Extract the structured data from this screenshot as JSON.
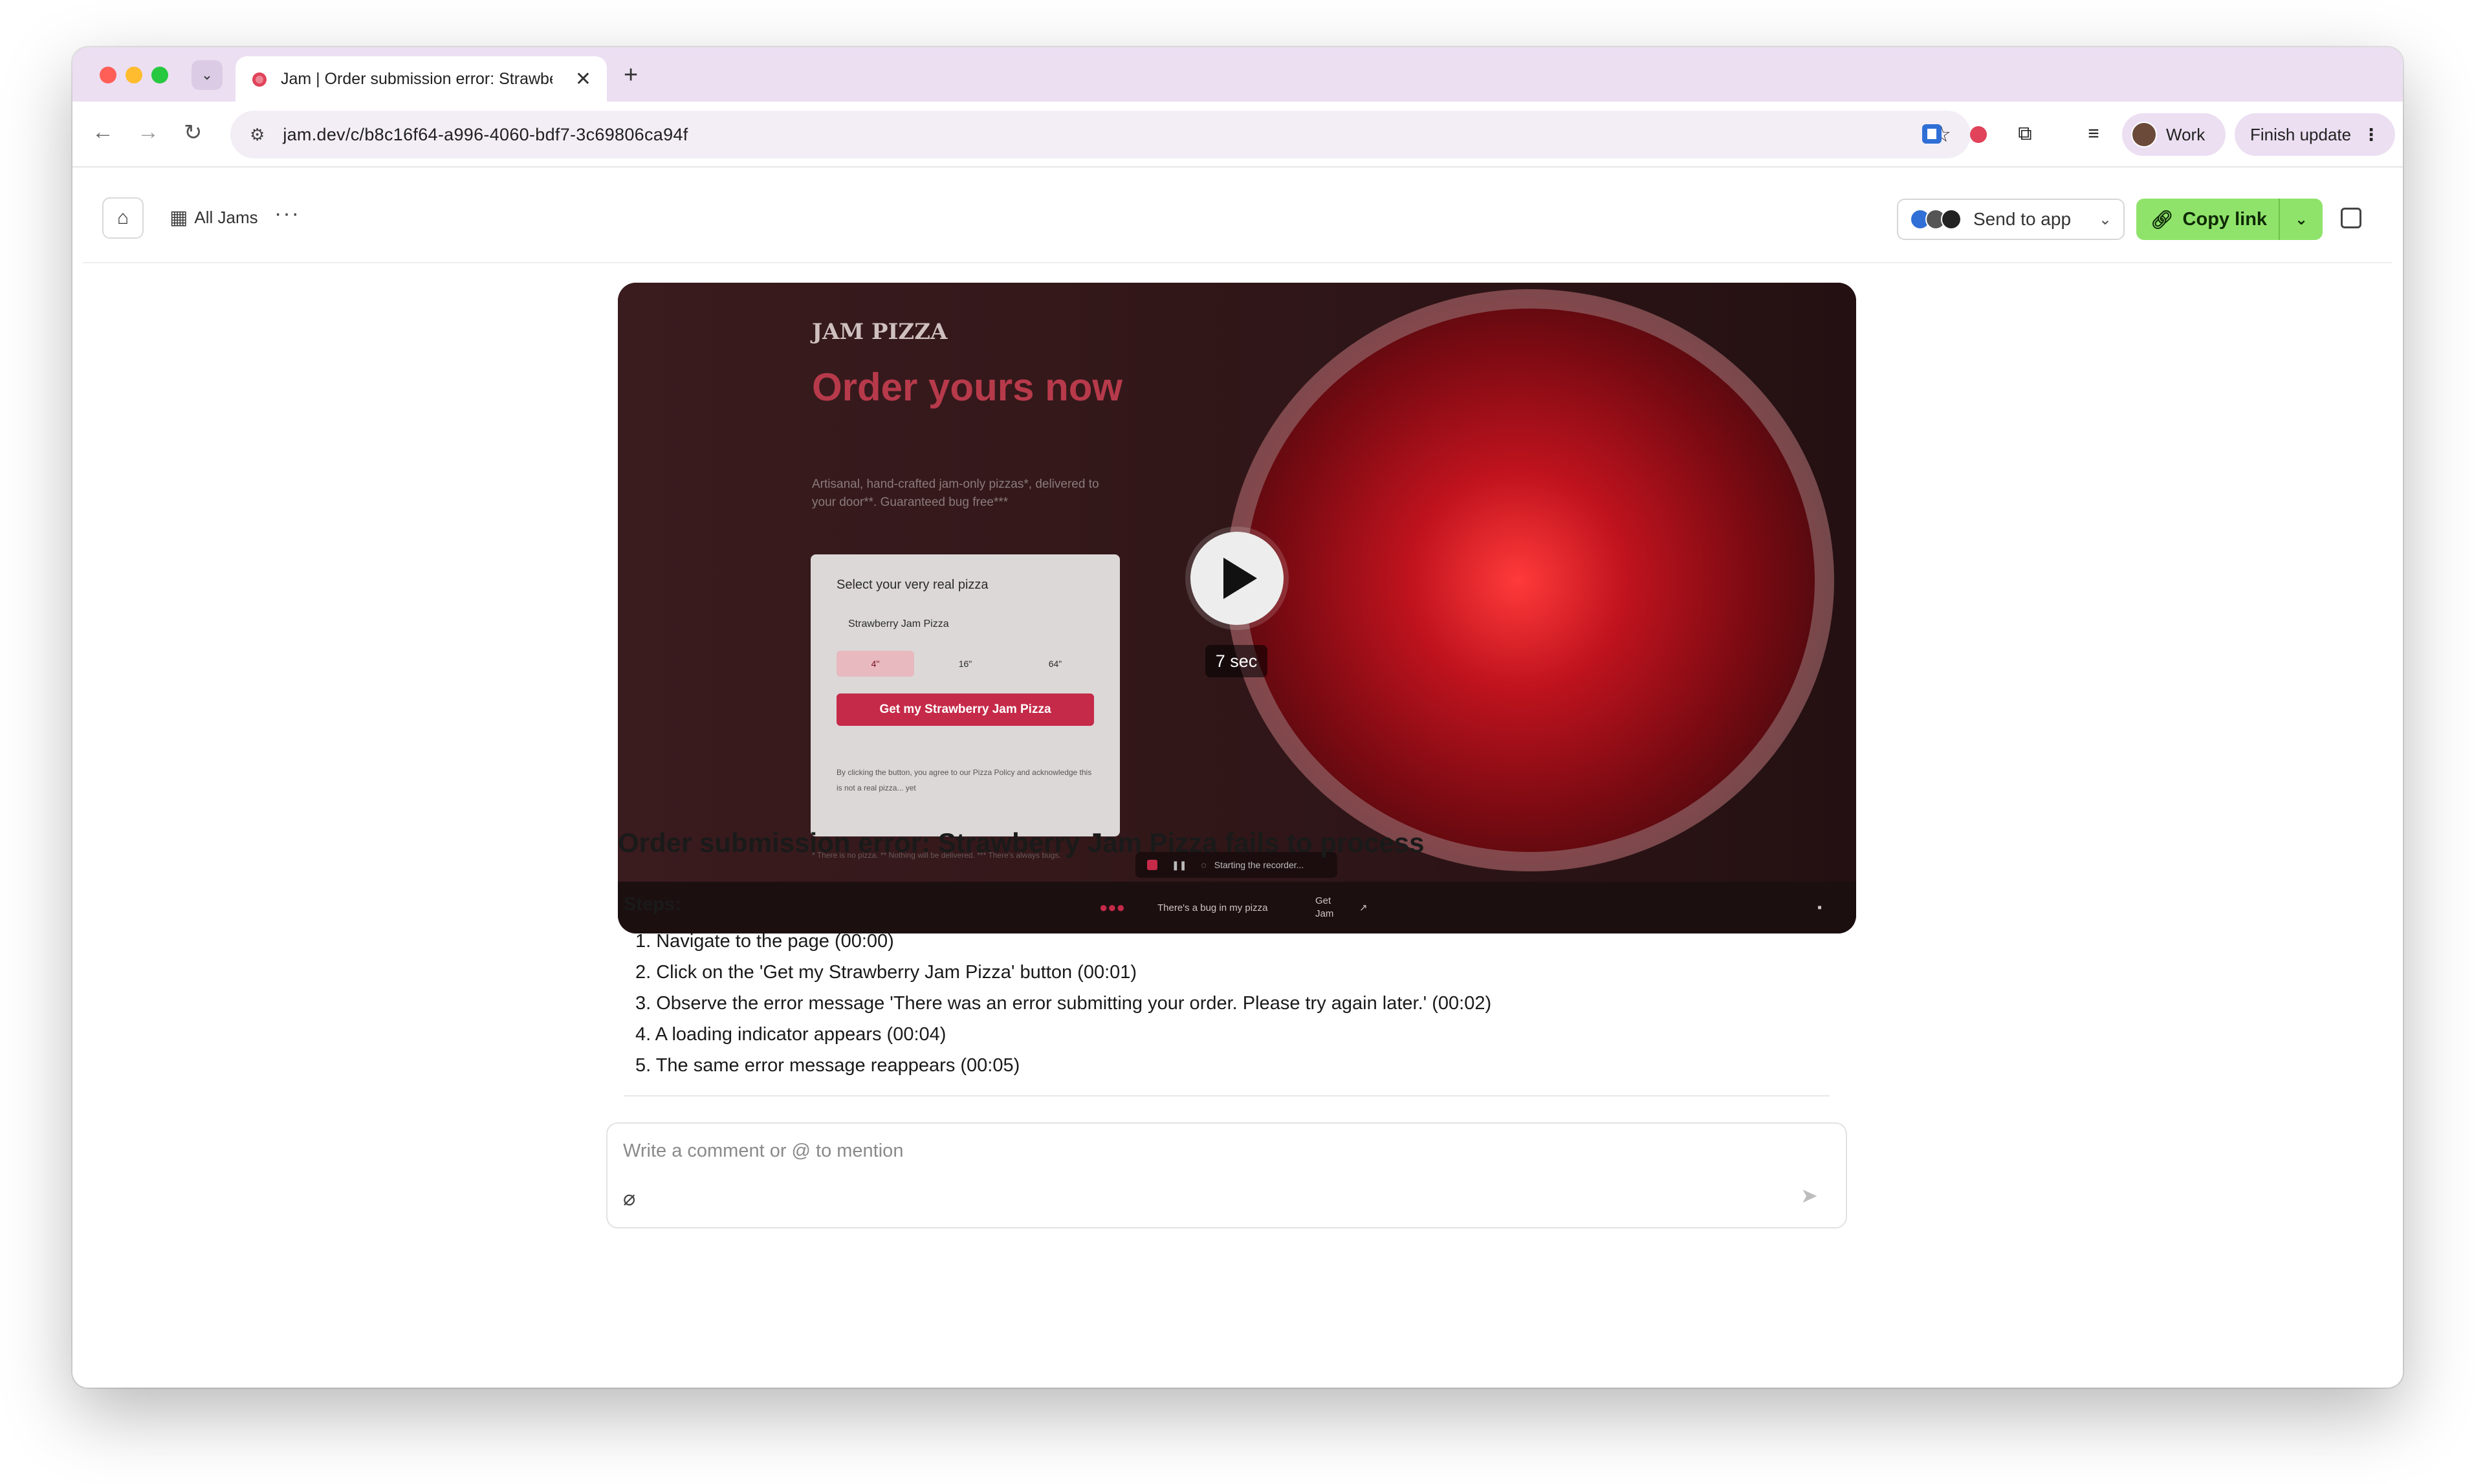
{
  "browser": {
    "tab": {
      "title": "Jam | Order submission error: Strawberry Jam Pizza fails to process",
      "close": "✕"
    },
    "new_tab": "+",
    "url": "jam.dev/c/b8c16f64-a996-4060-bdf7-3c69806ca94f",
    "profile": "Work",
    "finish_update": "Finish update",
    "colors": {
      "tabstrip": "#ecdff2",
      "accent_green": "#8fe36b"
    }
  },
  "header": {
    "all_jams": "All Jams",
    "send_to_app": "Send to app",
    "copy_link": "Copy link"
  },
  "video": {
    "duration": "7 sec",
    "preview": {
      "logo": "JAM PIZZA",
      "headline": "Order yours now",
      "subline": "Artisanal, hand-crafted jam-only pizzas*, delivered to your door**. Guaranteed bug free***",
      "form_title": "Select your very real pizza",
      "select_value": "Strawberry Jam Pizza",
      "sizes": [
        "4\"",
        "16\"",
        "64\""
      ],
      "cta": "Get my Strawberry Jam Pizza",
      "legal": "By clicking the button, you agree to our Pizza Policy and acknowledge this is not a real pizza... yet",
      "footnote": "* There is no pizza. ** Nothing will be delivered. *** There's always bugs.",
      "recorder_status": "Starting the recorder..."
    },
    "bar": {
      "text": "There's a bug in my pizza",
      "get_jam": "Get Jam"
    }
  },
  "issue": {
    "title": "Order submission error: Strawberry Jam Pizza fails to process",
    "steps_label": "Steps:",
    "steps": [
      "1. Navigate to the page (00:00)",
      "2. Click on the 'Get my Strawberry Jam Pizza' button (00:01)",
      "3. Observe the error message 'There was an error submitting your order. Please try again later.' (00:02)",
      "4. A loading indicator appears (00:04)",
      "5. The same error message reappears (00:05)"
    ]
  },
  "comment": {
    "placeholder": "Write a comment or @ to mention"
  }
}
